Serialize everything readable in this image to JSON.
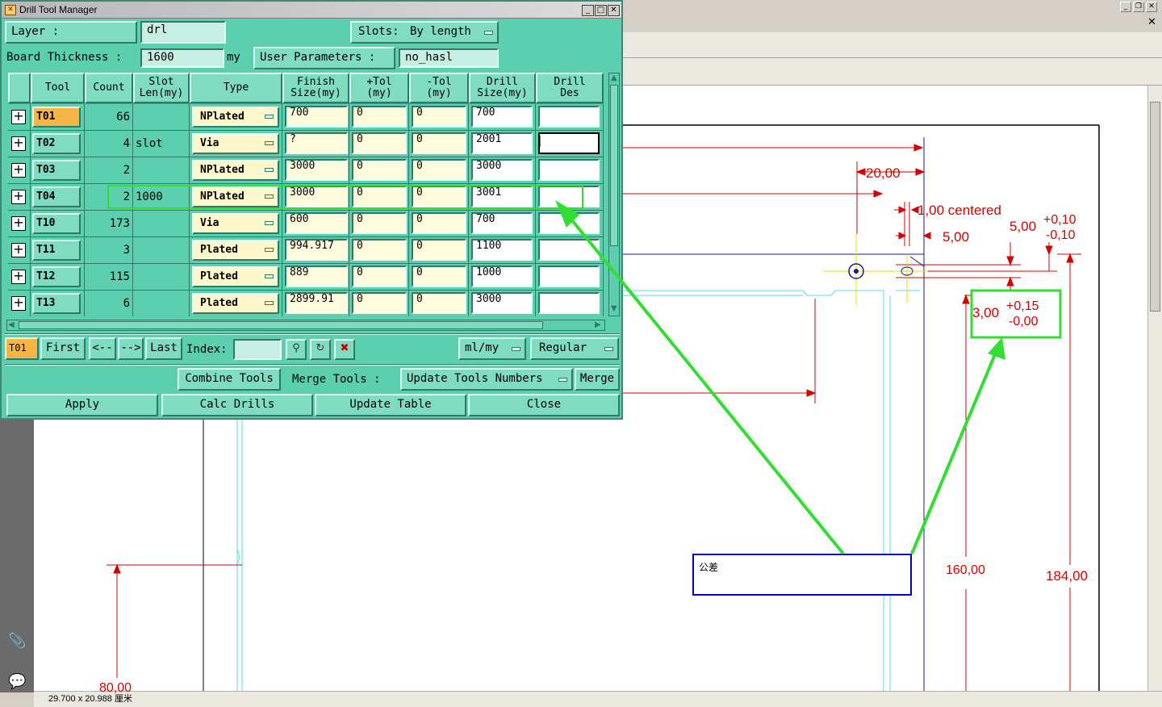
{
  "dialog": {
    "title": "Drill Tool Manager",
    "layer_label": "Layer :",
    "layer_value": "drl",
    "slots_label": "Slots:",
    "slots_value": "By length",
    "board_thickness_label": "Board Thickness :",
    "board_thickness_value": "1600",
    "board_thickness_unit": "my",
    "user_params_label": "User Parameters :",
    "user_params_value": "no_hasl",
    "columns": [
      "",
      "Tool",
      "Count",
      "Slot\nLen(my)",
      "Type",
      "Finish\nSize(my)",
      "+Tol\n(my)",
      "-Tol\n(my)",
      "Drill\nSize(my)",
      "Drill\nDes"
    ],
    "rows": [
      {
        "tool": "T01",
        "count": "66",
        "slot": "",
        "type": "NPlated",
        "finish": "700",
        "ptol": "0",
        "mtol": "0",
        "drill": "700",
        "des": ""
      },
      {
        "tool": "T02",
        "count": "4",
        "slot": "slot",
        "type": "Via",
        "finish": "?",
        "ptol": "0",
        "mtol": "0",
        "drill": "2001",
        "des": ""
      },
      {
        "tool": "T03",
        "count": "2",
        "slot": "",
        "type": "NPlated",
        "finish": "3000",
        "ptol": "0",
        "mtol": "0",
        "drill": "3000",
        "des": ""
      },
      {
        "tool": "T04",
        "count": "2",
        "slot": "1000",
        "type": "NPlated",
        "finish": "3000",
        "ptol": "0",
        "mtol": "0",
        "drill": "3001",
        "des": ""
      },
      {
        "tool": "T10",
        "count": "173",
        "slot": "",
        "type": "Via",
        "finish": "600",
        "ptol": "0",
        "mtol": "0",
        "drill": "700",
        "des": ""
      },
      {
        "tool": "T11",
        "count": "3",
        "slot": "",
        "type": "Plated",
        "finish": "994.917",
        "ptol": "0",
        "mtol": "0",
        "drill": "1100",
        "des": ""
      },
      {
        "tool": "T12",
        "count": "115",
        "slot": "",
        "type": "Plated",
        "finish": "889",
        "ptol": "0",
        "mtol": "0",
        "drill": "1000",
        "des": ""
      },
      {
        "tool": "T13",
        "count": "6",
        "slot": "",
        "type": "Plated",
        "finish": "2899.91",
        "ptol": "0",
        "mtol": "0",
        "drill": "3000",
        "des": ""
      }
    ],
    "current_tool": "T01",
    "nav": {
      "first": "First",
      "prev": "<--",
      "next": "-->",
      "last": "Last",
      "index_label": "Index:",
      "index_value": ""
    },
    "units_value": "ml/my",
    "mode_value": "Regular",
    "combine_tools": "Combine Tools",
    "merge_tools_label": "Merge Tools :",
    "update_tools_numbers": "Update Tools Numbers",
    "merge": "Merge",
    "apply": "Apply",
    "calc_drills": "Calc Drills",
    "update_table": "Update Table",
    "close": "Close"
  },
  "viewer": {
    "page_size": "29.700 x 20.988 厘米",
    "note_text": "公差"
  },
  "drawing": {
    "dim_20": "20,00",
    "dim_1": "1,00 centered",
    "dim_5": "5,00",
    "tol_5": "5,00",
    "tol_5_plus": "+0,10",
    "tol_5_minus": "-0,10",
    "dim_3": "3,00",
    "tol_3_plus": "+0,15",
    "tol_3_minus": "-0,00",
    "dim_160": "160,00",
    "dim_184": "184,00",
    "dim_80": "80,00"
  },
  "colors": {
    "dialog_bg": "#5ccfaf",
    "dimension_red": "#d40000",
    "callout_green": "#33dd33",
    "note_border_blue": "#0000c8",
    "cyan_outline": "#5fd8e0"
  }
}
